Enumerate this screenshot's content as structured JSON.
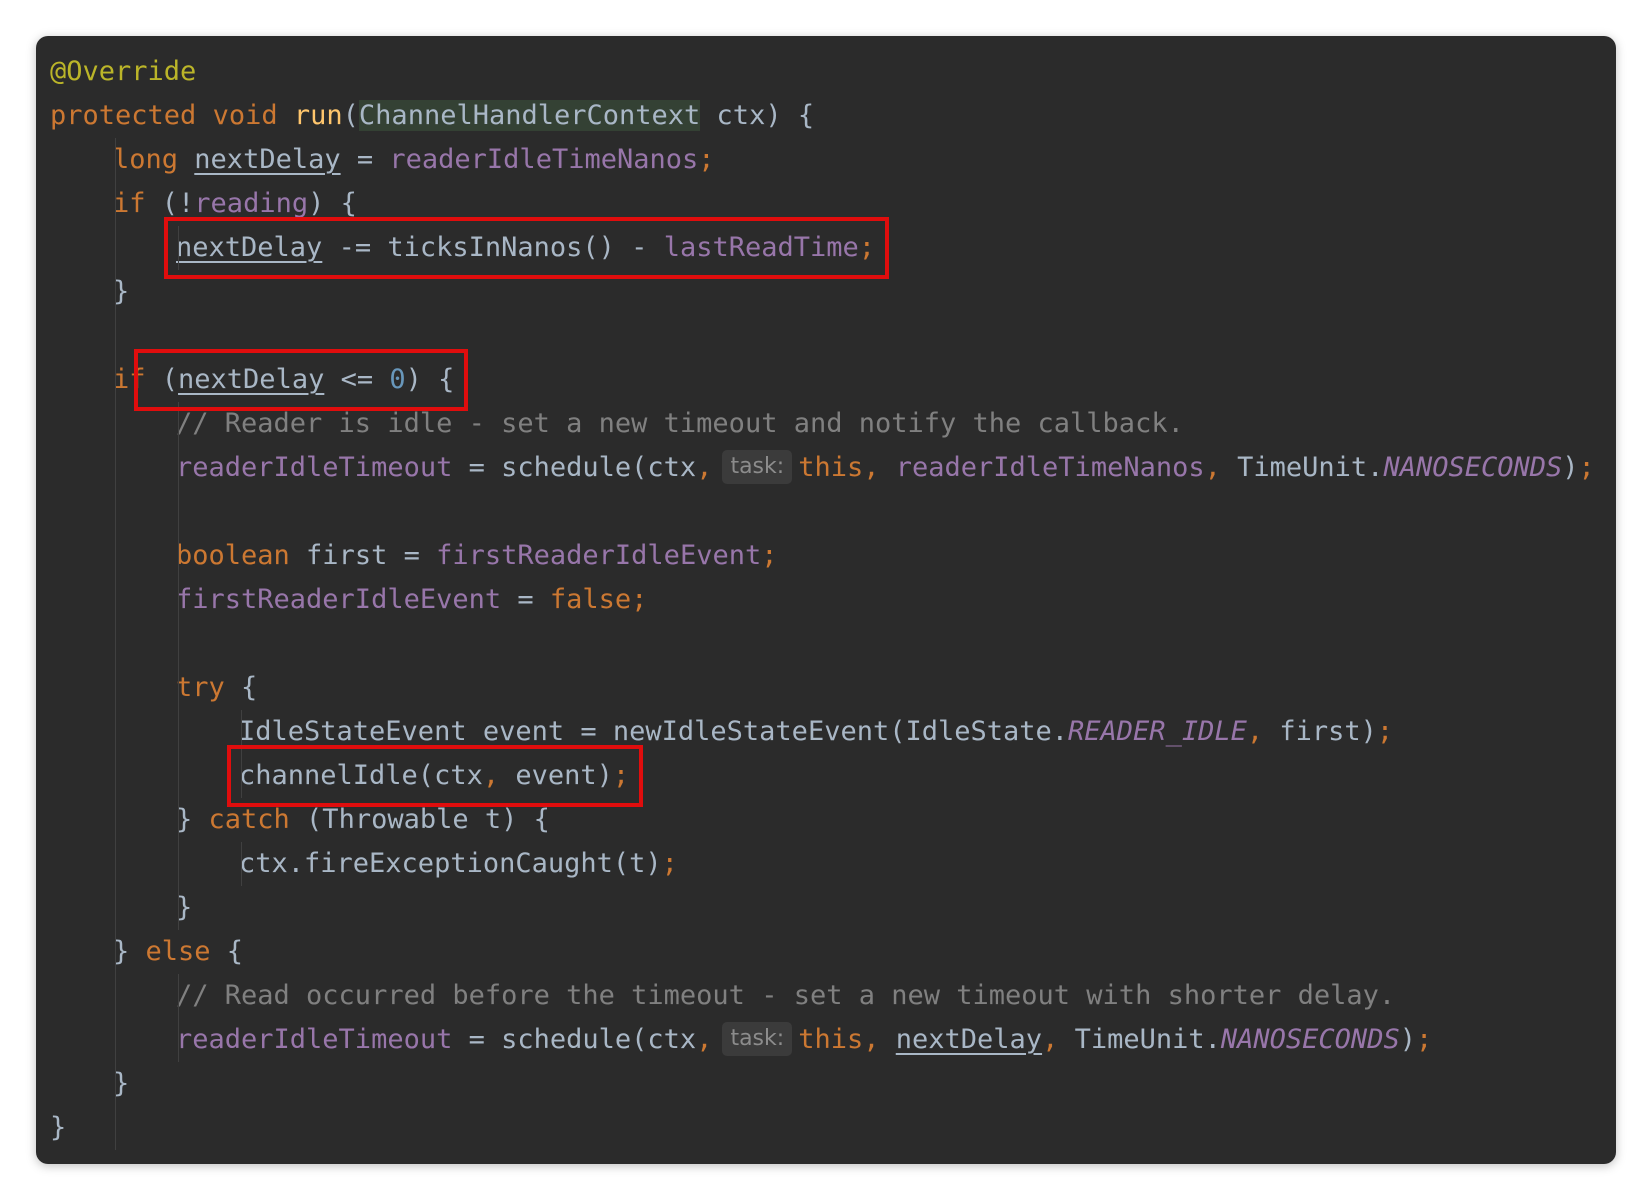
{
  "lines": [
    {
      "indent": 0,
      "tokens": [
        {
          "t": "@Override",
          "c": "ann"
        }
      ]
    },
    {
      "indent": 0,
      "tokens": [
        {
          "t": "protected",
          "c": "kw"
        },
        {
          "t": " "
        },
        {
          "t": "void",
          "c": "kw"
        },
        {
          "t": " "
        },
        {
          "t": "run",
          "c": "fn"
        },
        {
          "t": "("
        },
        {
          "t": "ChannelHandlerContext",
          "c": "ptype"
        },
        {
          "t": " ctx) {"
        }
      ]
    },
    {
      "indent": 1,
      "tokens": [
        {
          "t": "long",
          "c": "kw"
        },
        {
          "t": " "
        },
        {
          "t": "nextDelay",
          "c": "var"
        },
        {
          "t": " = "
        },
        {
          "t": "readerIdleTimeNanos",
          "c": "field"
        },
        {
          "t": ";",
          "c": "kw"
        }
      ]
    },
    {
      "indent": 1,
      "tokens": [
        {
          "t": "if",
          "c": "kw"
        },
        {
          "t": " (!"
        },
        {
          "t": "reading",
          "c": "field"
        },
        {
          "t": ") {"
        }
      ]
    },
    {
      "indent": 2,
      "tokens": [
        {
          "t": "nextDelay",
          "c": "var"
        },
        {
          "t": " -= ticksInNanos() - "
        },
        {
          "t": "lastReadTime",
          "c": "field"
        },
        {
          "t": ";",
          "c": "kw"
        }
      ]
    },
    {
      "indent": 1,
      "tokens": [
        {
          "t": "}"
        }
      ]
    },
    {
      "indent": 0,
      "tokens": []
    },
    {
      "indent": 1,
      "tokens": [
        {
          "t": "if",
          "c": "kw"
        },
        {
          "t": " ("
        },
        {
          "t": "nextDelay",
          "c": "var"
        },
        {
          "t": " <= "
        },
        {
          "t": "0",
          "c": "num"
        },
        {
          "t": ") {"
        }
      ]
    },
    {
      "indent": 2,
      "tokens": [
        {
          "t": "// Reader is idle - set a new timeout and notify the callback.",
          "c": "cm"
        }
      ]
    },
    {
      "indent": 2,
      "tokens": [
        {
          "t": "readerIdleTimeout",
          "c": "field"
        },
        {
          "t": " = schedule(ctx"
        },
        {
          "t": ",",
          "c": "kw"
        },
        {
          "t": "task:",
          "c": "hint"
        },
        {
          "t": "this",
          "c": "kw"
        },
        {
          "t": ",",
          "c": "kw"
        },
        {
          "t": " "
        },
        {
          "t": "readerIdleTimeNanos",
          "c": "field"
        },
        {
          "t": ",",
          "c": "kw"
        },
        {
          "t": " TimeUnit."
        },
        {
          "t": "NANOSECONDS",
          "c": "const"
        },
        {
          "t": ")"
        },
        {
          "t": ";",
          "c": "kw"
        }
      ]
    },
    {
      "indent": 0,
      "tokens": []
    },
    {
      "indent": 2,
      "tokens": [
        {
          "t": "boolean",
          "c": "kw"
        },
        {
          "t": " first = "
        },
        {
          "t": "firstReaderIdleEvent",
          "c": "field"
        },
        {
          "t": ";",
          "c": "kw"
        }
      ]
    },
    {
      "indent": 2,
      "tokens": [
        {
          "t": "firstReaderIdleEvent",
          "c": "field"
        },
        {
          "t": " = "
        },
        {
          "t": "false",
          "c": "kw"
        },
        {
          "t": ";",
          "c": "kw"
        }
      ]
    },
    {
      "indent": 0,
      "tokens": []
    },
    {
      "indent": 2,
      "tokens": [
        {
          "t": "try",
          "c": "kw"
        },
        {
          "t": " {"
        }
      ]
    },
    {
      "indent": 3,
      "tokens": [
        {
          "t": "IdleStateEvent event = newIdleStateEvent(IdleState."
        },
        {
          "t": "READER_IDLE",
          "c": "const"
        },
        {
          "t": ",",
          "c": "kw"
        },
        {
          "t": " first)"
        },
        {
          "t": ";",
          "c": "kw"
        }
      ]
    },
    {
      "indent": 3,
      "tokens": [
        {
          "t": "channelIdle(ctx"
        },
        {
          "t": ",",
          "c": "kw"
        },
        {
          "t": " event)"
        },
        {
          "t": ";",
          "c": "kw"
        }
      ]
    },
    {
      "indent": 2,
      "tokens": [
        {
          "t": "} "
        },
        {
          "t": "catch",
          "c": "kw"
        },
        {
          "t": " (Throwable t) {"
        }
      ]
    },
    {
      "indent": 3,
      "tokens": [
        {
          "t": "ctx.fireExceptionCaught(t)"
        },
        {
          "t": ";",
          "c": "kw"
        }
      ]
    },
    {
      "indent": 2,
      "tokens": [
        {
          "t": "}"
        }
      ]
    },
    {
      "indent": 1,
      "tokens": [
        {
          "t": "} "
        },
        {
          "t": "else",
          "c": "kw"
        },
        {
          "t": " {"
        }
      ]
    },
    {
      "indent": 2,
      "tokens": [
        {
          "t": "// Read occurred before the timeout - set a new timeout with shorter delay.",
          "c": "cm"
        }
      ]
    },
    {
      "indent": 2,
      "tokens": [
        {
          "t": "readerIdleTimeout",
          "c": "field"
        },
        {
          "t": " = schedule(ctx"
        },
        {
          "t": ",",
          "c": "kw"
        },
        {
          "t": "task:",
          "c": "hint"
        },
        {
          "t": "this",
          "c": "kw"
        },
        {
          "t": ",",
          "c": "kw"
        },
        {
          "t": " "
        },
        {
          "t": "nextDelay",
          "c": "var"
        },
        {
          "t": ",",
          "c": "kw"
        },
        {
          "t": " TimeUnit."
        },
        {
          "t": "NANOSECONDS",
          "c": "const"
        },
        {
          "t": ")"
        },
        {
          "t": ";",
          "c": "kw"
        }
      ]
    },
    {
      "indent": 1,
      "tokens": [
        {
          "t": "}"
        }
      ]
    },
    {
      "indent": 0,
      "tokens": [
        {
          "t": "}"
        }
      ]
    }
  ],
  "highlights": [
    {
      "line": 4,
      "label": "nextDelay -= ticksInNanos() - lastReadTime;"
    },
    {
      "line": 7,
      "label": "(nextDelay <= 0)"
    },
    {
      "line": 16,
      "label": "channelIdle(ctx, event);"
    }
  ],
  "colors": {
    "background": "#2b2b2b",
    "text": "#a9b7c6",
    "keyword": "#cc7832",
    "method_declaration": "#ffc66d",
    "field": "#9876aa",
    "number": "#6897bb",
    "comment": "#808080",
    "annotation": "#bbb529",
    "highlight_box": "#e00d0d"
  }
}
